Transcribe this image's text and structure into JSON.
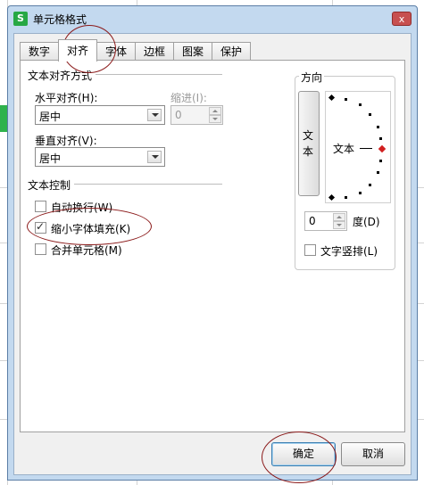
{
  "dialog": {
    "title": "单元格格式",
    "app_icon": "S",
    "close_icon": "x"
  },
  "tabs": [
    {
      "label": "数字"
    },
    {
      "label": "对齐"
    },
    {
      "label": "字体"
    },
    {
      "label": "边框"
    },
    {
      "label": "图案"
    },
    {
      "label": "保护"
    }
  ],
  "active_tab": "对齐",
  "text_alignment": {
    "group_title": "文本对齐方式",
    "horizontal_label": "水平对齐(H):",
    "horizontal_value": "居中",
    "indent_label": "缩进(I):",
    "indent_value": "0",
    "vertical_label": "垂直对齐(V):",
    "vertical_value": "居中"
  },
  "text_control": {
    "group_title": "文本控制",
    "wrap_text": {
      "label": "自动换行(W)",
      "checked": false
    },
    "shrink_to_fit": {
      "label": "缩小字体填充(K)",
      "checked": true
    },
    "merge_cells": {
      "label": "合并单元格(M)",
      "checked": false
    }
  },
  "orientation": {
    "group_title": "方向",
    "vertical_text_button": "文本",
    "dial_text": "文本",
    "degrees_value": "0",
    "degrees_label": "度(D)",
    "vertical_layout": {
      "label": "文字竖排(L)",
      "checked": false
    }
  },
  "buttons": {
    "ok": "确定",
    "cancel": "取消"
  },
  "colors": {
    "title_bar": "#c3d9ef",
    "close_button": "#c75050",
    "annotation_ring": "#8b1a1a",
    "dial_indicator": "#d11f1f"
  }
}
